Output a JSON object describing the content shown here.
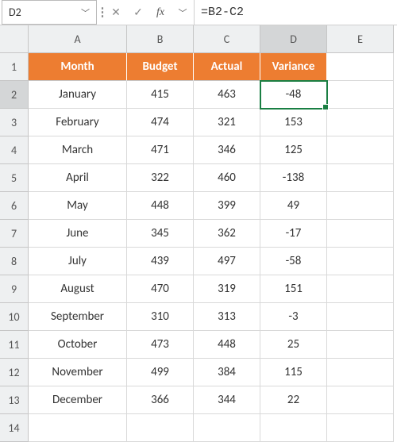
{
  "nameBox": "D2",
  "formula": "=B2-C2",
  "columns": [
    "A",
    "B",
    "C",
    "D",
    "E"
  ],
  "activeCol": "D",
  "activeRow": 2,
  "headers": {
    "A": "Month",
    "B": "Budget",
    "C": "Actual",
    "D": "Variance"
  },
  "rows": [
    {
      "n": 1
    },
    {
      "n": 2,
      "A": "January",
      "B": 415,
      "C": 463,
      "D": -48
    },
    {
      "n": 3,
      "A": "February",
      "B": 474,
      "C": 321,
      "D": 153
    },
    {
      "n": 4,
      "A": "March",
      "B": 471,
      "C": 346,
      "D": 125
    },
    {
      "n": 5,
      "A": "April",
      "B": 322,
      "C": 460,
      "D": -138
    },
    {
      "n": 6,
      "A": "May",
      "B": 448,
      "C": 399,
      "D": 49
    },
    {
      "n": 7,
      "A": "June",
      "B": 345,
      "C": 362,
      "D": -17
    },
    {
      "n": 8,
      "A": "July",
      "B": 439,
      "C": 497,
      "D": -58
    },
    {
      "n": 9,
      "A": "August",
      "B": 470,
      "C": 319,
      "D": 151
    },
    {
      "n": 10,
      "A": "September",
      "B": 310,
      "C": 313,
      "D": -3
    },
    {
      "n": 11,
      "A": "October",
      "B": 473,
      "C": 448,
      "D": 25
    },
    {
      "n": 12,
      "A": "November",
      "B": 499,
      "C": 384,
      "D": 115
    },
    {
      "n": 13,
      "A": "December",
      "B": 366,
      "C": 344,
      "D": 22
    },
    {
      "n": 14
    }
  ]
}
